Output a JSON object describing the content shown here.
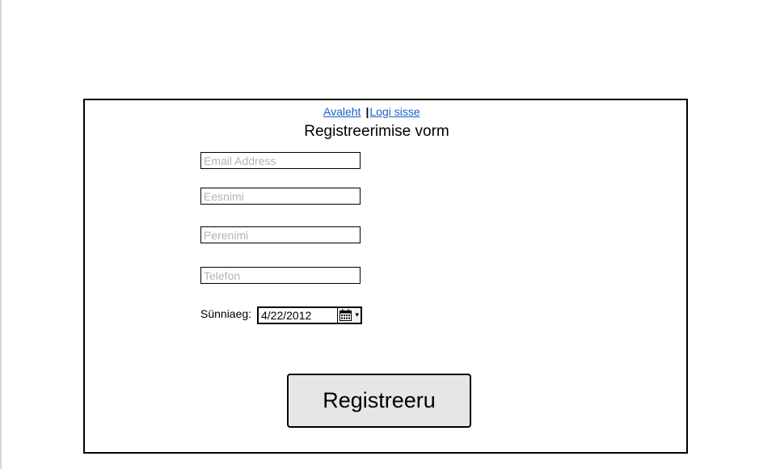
{
  "nav": {
    "home_link": "Avaleht",
    "separator": "|",
    "login_link": "Logi sisse"
  },
  "form": {
    "title": "Registreerimise vorm",
    "email_placeholder": "Email Address",
    "first_name_placeholder": "Eesnimi",
    "last_name_placeholder": "Perenimi",
    "phone_placeholder": "Telefon",
    "birthdate_label": "Sünniaeg:",
    "birthdate_value": "4/22/2012",
    "birthdate_icon": "calendar-icon",
    "dropdown_arrow": "▾",
    "submit_label": "Registreeru"
  },
  "colors": {
    "link": "#1a5fd1",
    "placeholder": "#b3b3b3",
    "button_bg": "#e6e6e6"
  }
}
